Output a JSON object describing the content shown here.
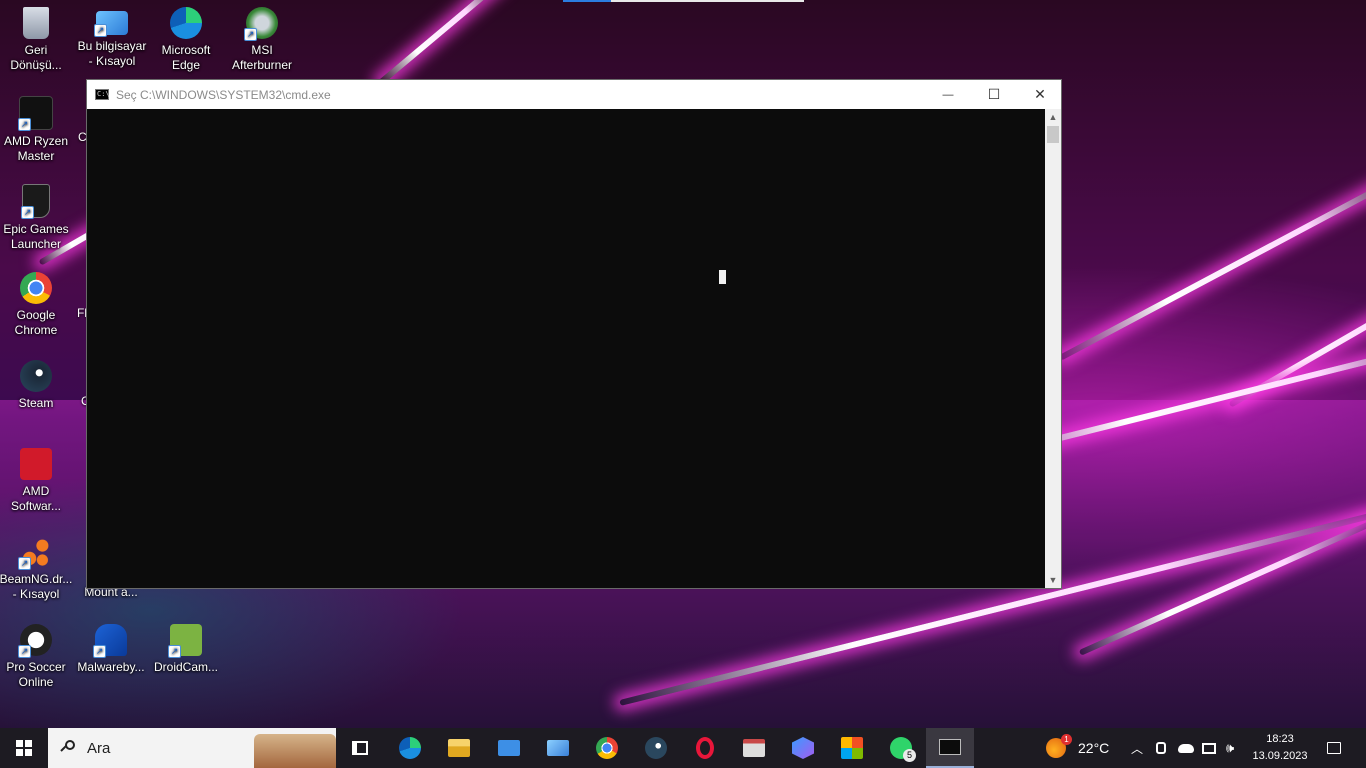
{
  "desktop": {
    "icons": [
      {
        "label": "Geri Dönüşü...",
        "icon": "recycle-bin-icon"
      },
      {
        "label": "Bu bilgisayar - Kısayol",
        "icon": "this-pc-icon"
      },
      {
        "label": "Microsoft Edge",
        "icon": "edge-icon"
      },
      {
        "label": "MSI Afterburner",
        "icon": "msi-afterburner-icon"
      },
      {
        "label": "AMD Ryzen Master",
        "icon": "ryzen-master-icon"
      },
      {
        "label": "Epic Games Launcher",
        "icon": "epic-games-icon"
      },
      {
        "label": "Google Chrome",
        "icon": "chrome-icon"
      },
      {
        "label": "Steam",
        "icon": "steam-icon"
      },
      {
        "label": "AMD Softwar...",
        "icon": "amd-software-icon"
      },
      {
        "label": "BeamNG.dr... - Kısayol",
        "icon": "beamng-icon"
      },
      {
        "label": "Mount a...",
        "icon": "mount-icon"
      },
      {
        "label": "Pro Soccer Online",
        "icon": "pro-soccer-icon"
      },
      {
        "label": "Malwareby...",
        "icon": "malwarebytes-icon"
      },
      {
        "label": "DroidCam...",
        "icon": "droidcam-icon"
      }
    ],
    "clipped_labels": [
      "C",
      "Fl",
      "C"
    ]
  },
  "cmd_window": {
    "title": "Seç C:\\WINDOWS\\SYSTEM32\\cmd.exe",
    "minimize": "—",
    "maximize": "☐",
    "close": "✕"
  },
  "taskbar": {
    "search_placeholder": "Ara",
    "apps": [
      {
        "name": "task-view",
        "color": "#ffffff"
      },
      {
        "name": "edge",
        "color": "#2d9ee0"
      },
      {
        "name": "file-explorer",
        "color": "#f4c542"
      },
      {
        "name": "mail",
        "color": "#3d8fe6"
      },
      {
        "name": "this-pc",
        "color": "#5aa0e6"
      },
      {
        "name": "chrome",
        "color": "#e84335"
      },
      {
        "name": "steam",
        "color": "#2a475e"
      },
      {
        "name": "opera",
        "color": "#e8163a"
      },
      {
        "name": "snipping",
        "color": "#9e9e9e"
      },
      {
        "name": "app-copilot",
        "color": "#6f7cf0"
      },
      {
        "name": "store",
        "color": "#f2b20f"
      },
      {
        "name": "whatsapp",
        "color": "#2fd46a"
      },
      {
        "name": "cmd",
        "color": "#0c0c0c"
      }
    ],
    "whatsapp_badge": "5",
    "weather_badge": "1",
    "weather": "22°C",
    "time": "18:23",
    "date": "13.09.2023"
  }
}
